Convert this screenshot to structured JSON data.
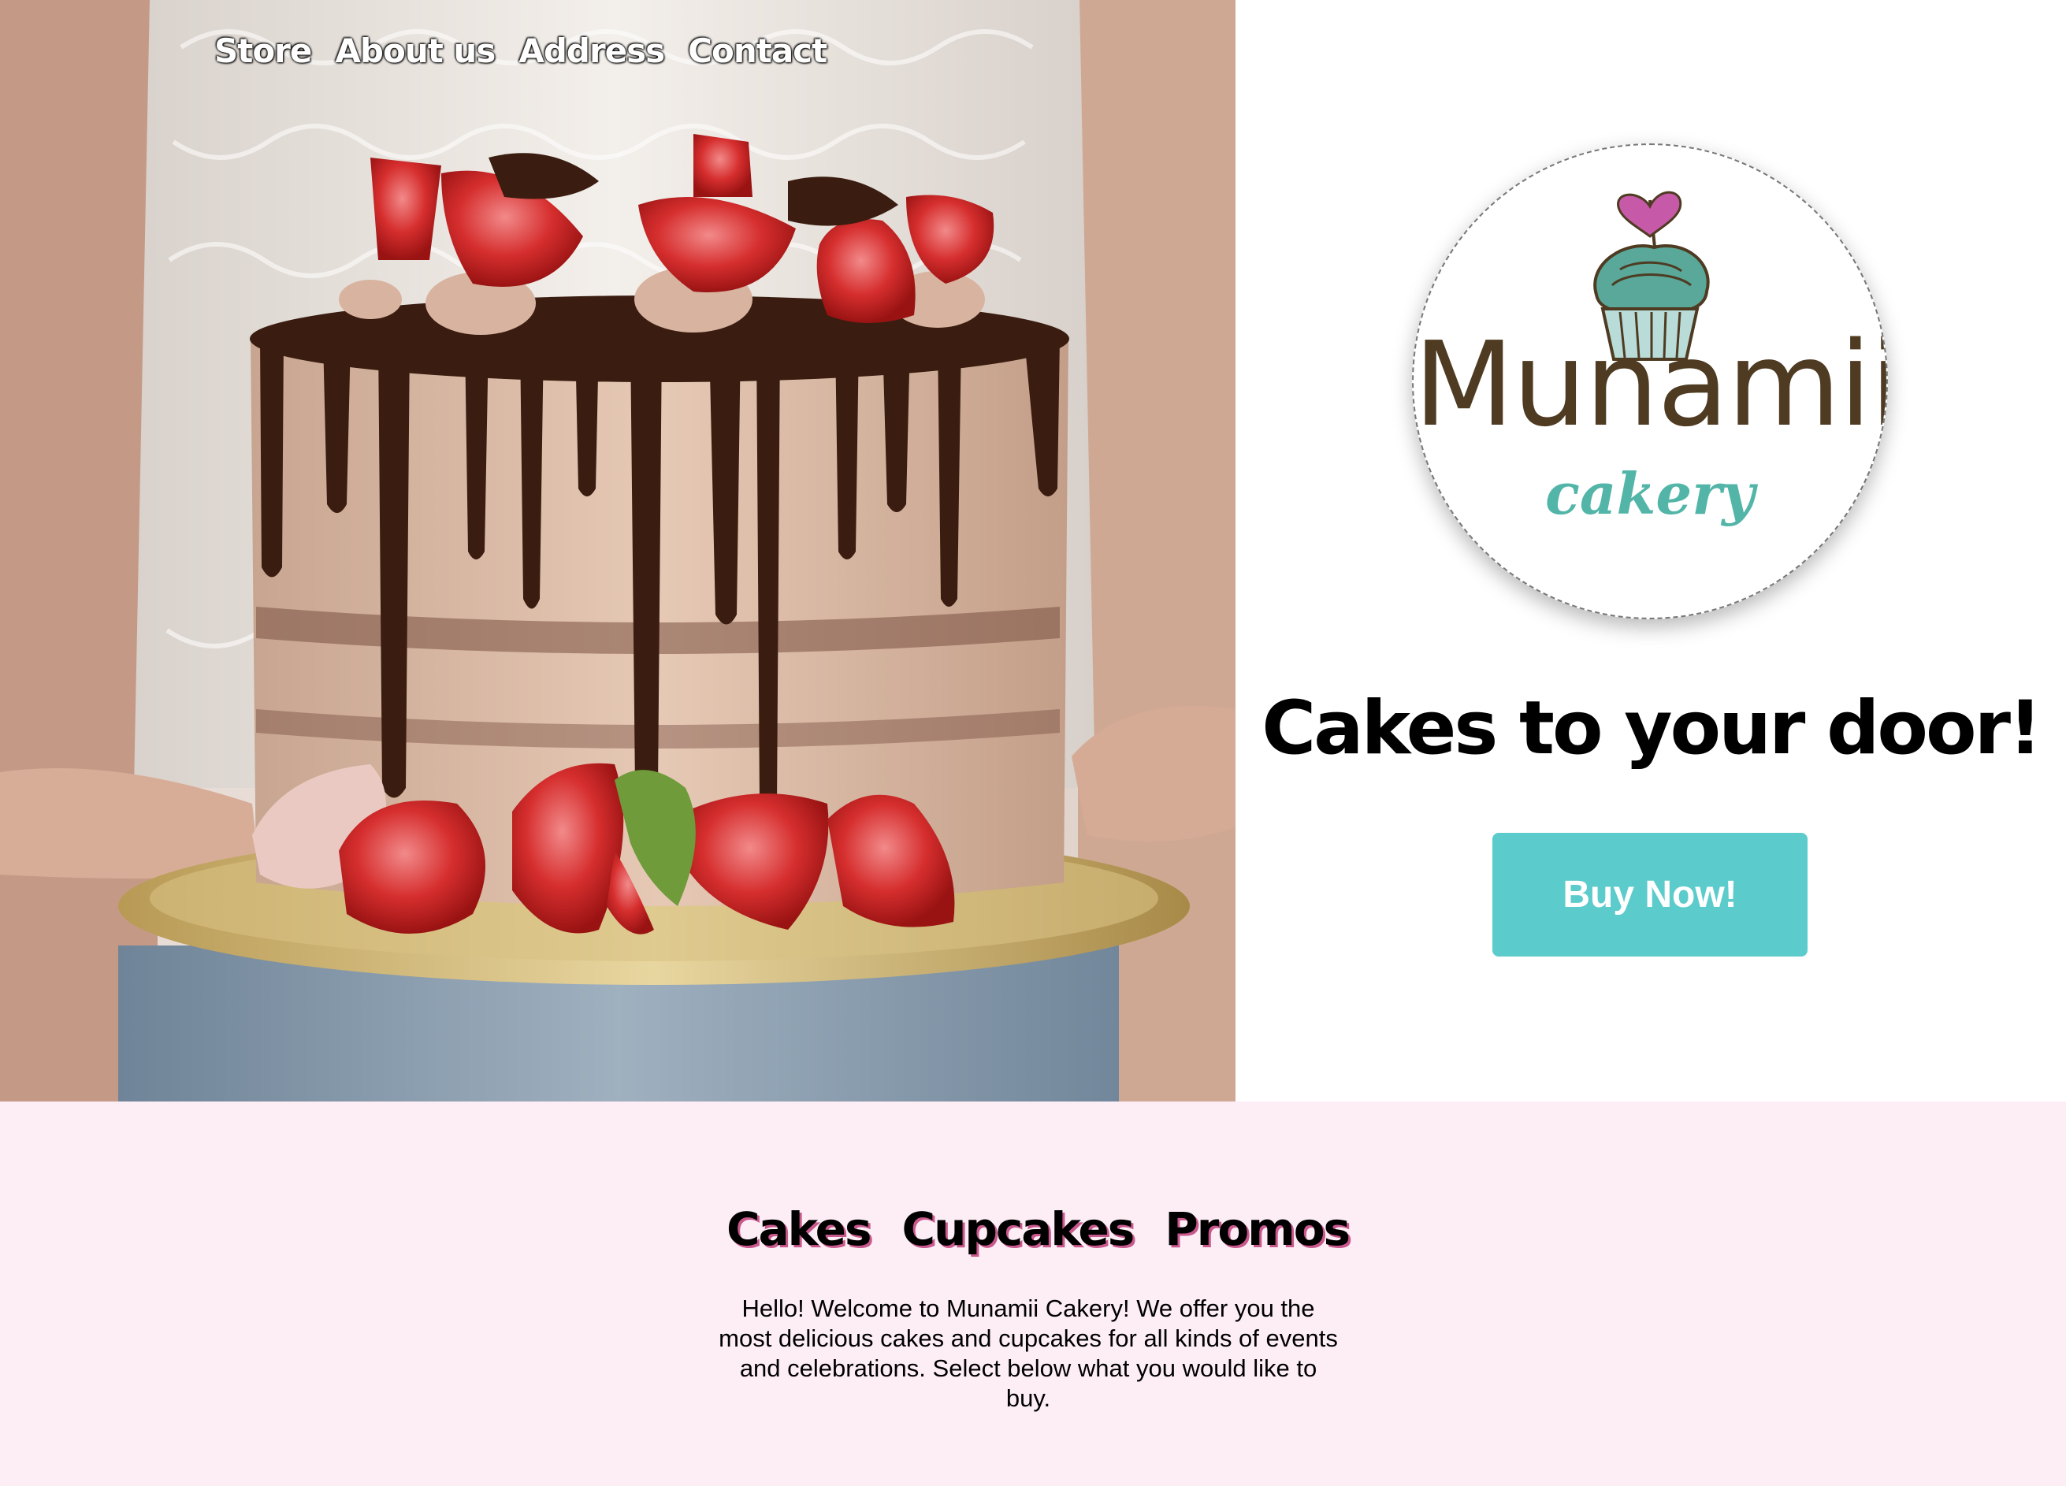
{
  "nav": {
    "items": [
      {
        "label": "Store"
      },
      {
        "label": "About us"
      },
      {
        "label": "Address"
      },
      {
        "label": "Contact"
      }
    ]
  },
  "hero": {
    "image_alt": "Chocolate drip cake topped with strawberries held on a gold board",
    "tagline": "Cakes to your door!",
    "cta_label": "Buy Now!"
  },
  "logo": {
    "word": "Munamii",
    "sub": "cakery",
    "icon": "cupcake-icon"
  },
  "categories": {
    "items": [
      {
        "label": "Cakes"
      },
      {
        "label": "Cupcakes"
      },
      {
        "label": "Promos"
      }
    ]
  },
  "welcome_text": "Hello! Welcome to Munamii Cakery! We offer you the most delicious cakes and cupcakes for all kinds of events and celebrations. Select below what you would like to buy.",
  "colors": {
    "accent": "#5ccbcc",
    "lower_bg": "#fdeef5",
    "logo_brown": "#4e3b22",
    "logo_teal": "#52b5a8",
    "heart": "#c65aa8",
    "category_shadow": "#c9588d"
  }
}
